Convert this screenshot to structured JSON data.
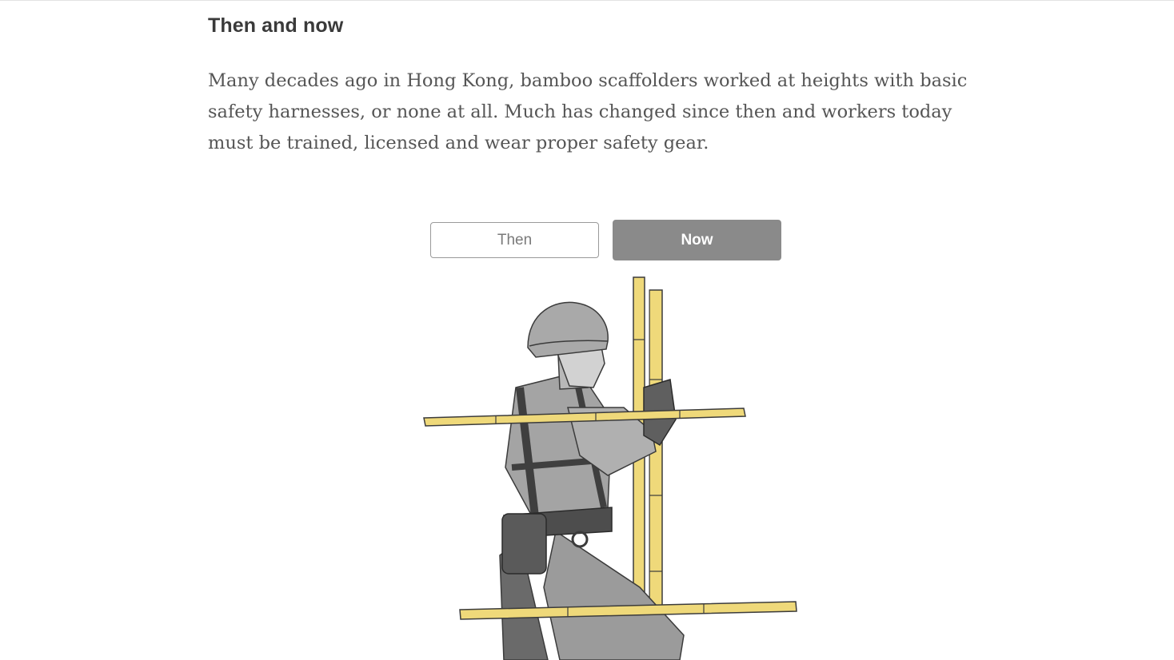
{
  "article": {
    "heading": "Then and now",
    "body": "Many decades ago in Hong Kong, bamboo scaffolders worked at heights with basic safety harnesses, or none at all. Much has changed since then and workers today must be trained, licensed and wear proper safety gear."
  },
  "toggle": {
    "then_label": "Then",
    "now_label": "Now",
    "selected": "Now"
  },
  "illustration": {
    "subject": "bamboo-scaffolder-illustration",
    "colors": {
      "bamboo": "#efd97a",
      "bamboo_shadow": "#c9b24a",
      "figure": "#9b9b9b",
      "figure_dark": "#5e5e5e",
      "outline": "#3b3b3b"
    }
  }
}
